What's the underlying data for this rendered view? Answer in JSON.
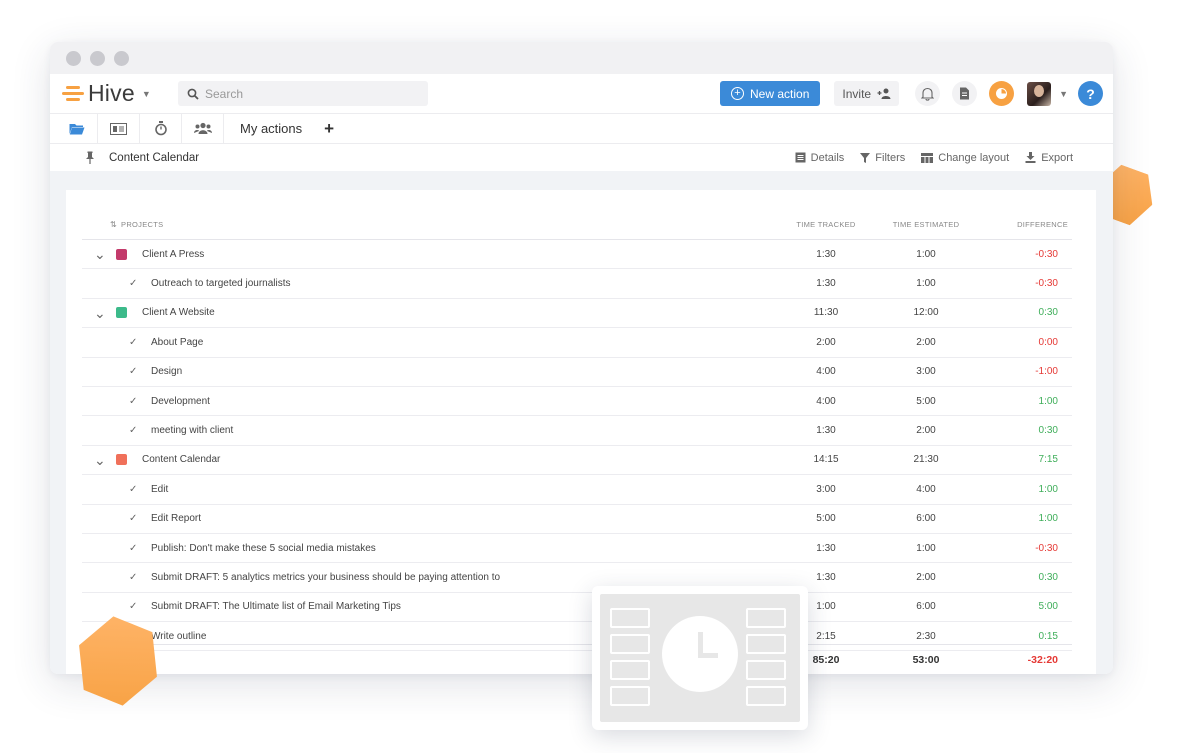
{
  "app": {
    "brand": "Hive",
    "search_placeholder": "Search",
    "new_action_label": "New action",
    "invite_label": "Invite",
    "help_label": "?"
  },
  "tabs": {
    "active_label": "My actions"
  },
  "toolbar": {
    "title": "Content Calendar",
    "details": "Details",
    "filters": "Filters",
    "change_layout": "Change layout",
    "export": "Export"
  },
  "table": {
    "headers": {
      "projects": "PROJECTS",
      "tracked": "TIME TRACKED",
      "estimated": "TIME ESTIMATED",
      "difference": "DIFFERENCE"
    },
    "rows": [
      {
        "type": "project",
        "name": "Client A Press",
        "color": "#c33a6b",
        "tracked": "1:30",
        "estimated": "1:00",
        "difference": "-0:30",
        "status": "neg"
      },
      {
        "type": "task",
        "name": "Outreach to targeted journalists",
        "tracked": "1:30",
        "estimated": "1:00",
        "difference": "-0:30",
        "status": "neg"
      },
      {
        "type": "project",
        "name": "Client A Website",
        "color": "#3cba8a",
        "tracked": "11:30",
        "estimated": "12:00",
        "difference": "0:30",
        "status": "pos"
      },
      {
        "type": "task",
        "name": "About Page",
        "tracked": "2:00",
        "estimated": "2:00",
        "difference": "0:00",
        "status": "neg"
      },
      {
        "type": "task",
        "name": "Design",
        "tracked": "4:00",
        "estimated": "3:00",
        "difference": "-1:00",
        "status": "neg"
      },
      {
        "type": "task",
        "name": "Development",
        "tracked": "4:00",
        "estimated": "5:00",
        "difference": "1:00",
        "status": "pos"
      },
      {
        "type": "task",
        "name": "meeting with client",
        "tracked": "1:30",
        "estimated": "2:00",
        "difference": "0:30",
        "status": "pos"
      },
      {
        "type": "project",
        "name": "Content Calendar",
        "color": "#f0705a",
        "tracked": "14:15",
        "estimated": "21:30",
        "difference": "7:15",
        "status": "pos"
      },
      {
        "type": "task",
        "name": "Edit",
        "tracked": "3:00",
        "estimated": "4:00",
        "difference": "1:00",
        "status": "pos"
      },
      {
        "type": "task",
        "name": "Edit Report",
        "tracked": "5:00",
        "estimated": "6:00",
        "difference": "1:00",
        "status": "pos"
      },
      {
        "type": "task",
        "name": "Publish: Don't make these 5 social media mistakes",
        "tracked": "1:30",
        "estimated": "1:00",
        "difference": "-0:30",
        "status": "neg"
      },
      {
        "type": "task",
        "name": "Submit DRAFT: 5 analytics metrics your business should be paying attention to",
        "tracked": "1:30",
        "estimated": "2:00",
        "difference": "0:30",
        "status": "pos"
      },
      {
        "type": "task",
        "name": "Submit DRAFT: The Ultimate list of Email Marketing Tips",
        "tracked": "1:00",
        "estimated": "6:00",
        "difference": "5:00",
        "status": "pos"
      },
      {
        "type": "task",
        "name": "Write outline",
        "tracked": "2:15",
        "estimated": "2:30",
        "difference": "0:15",
        "status": "pos"
      }
    ],
    "totals": {
      "tracked": "85:20",
      "estimated": "53:00",
      "difference": "-32:20"
    }
  },
  "colors": {
    "accent": "#3b8ad8",
    "brand_orange": "#f7a142",
    "negative": "#e53935",
    "positive": "#3fae5a"
  }
}
